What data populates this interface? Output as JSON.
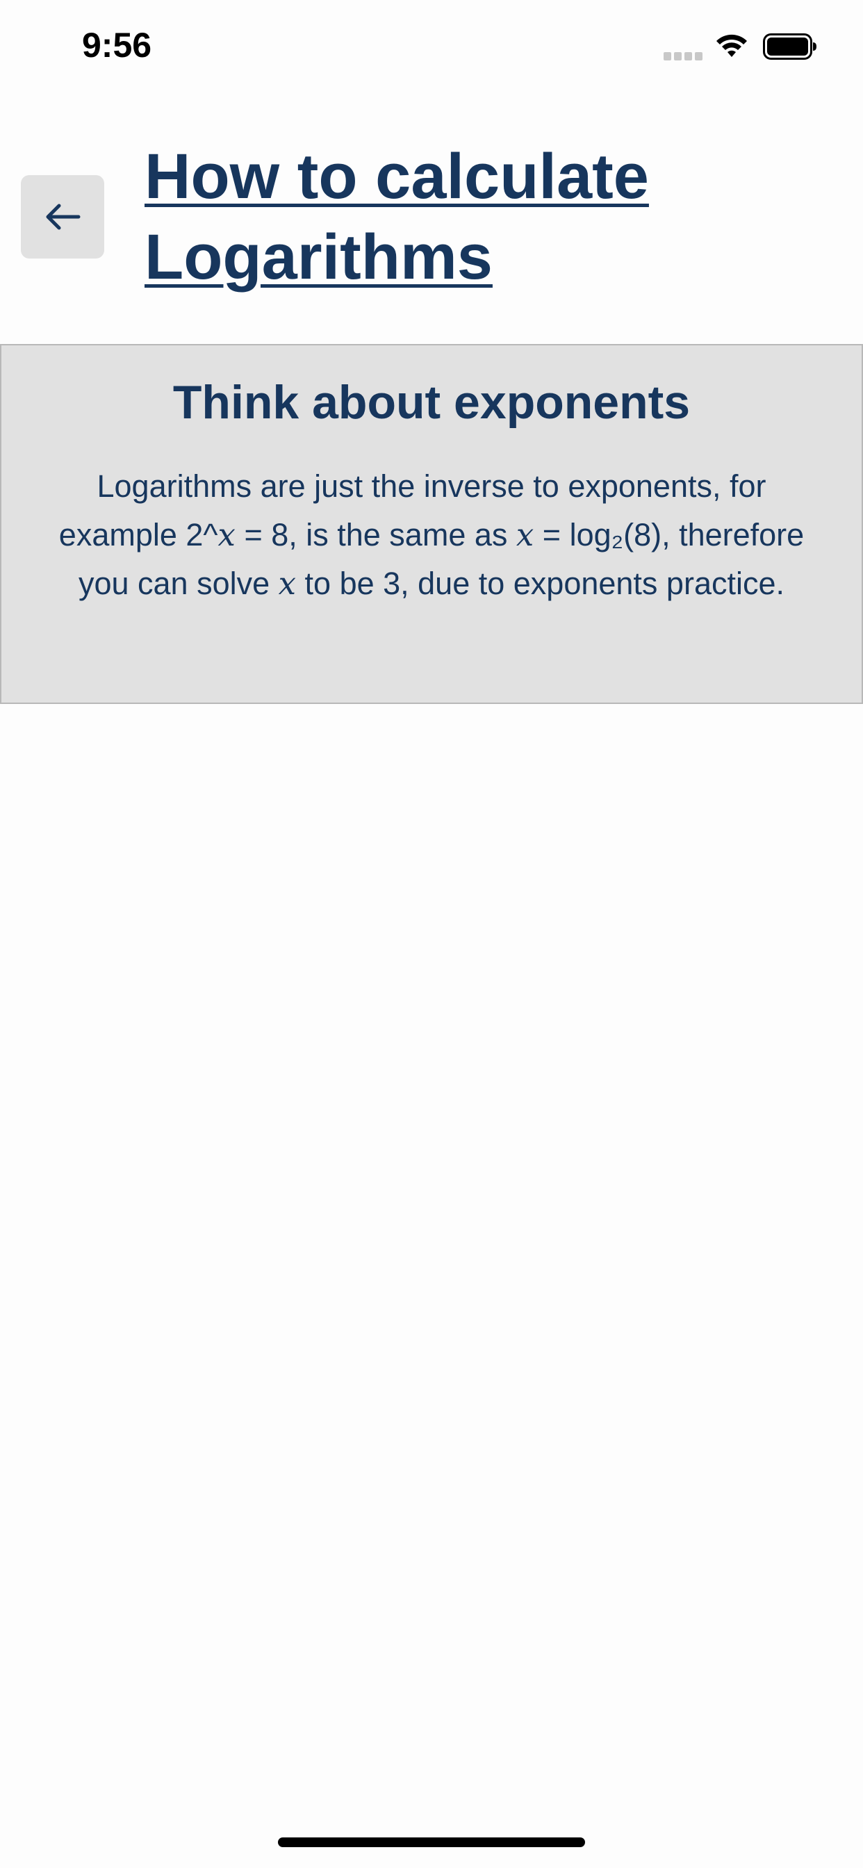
{
  "status_bar": {
    "time": "9:56",
    "icons": [
      "signal-icon",
      "wifi-icon",
      "battery-icon"
    ]
  },
  "header": {
    "back_icon": "arrow-left-icon",
    "title": "How to calculate Logarithms"
  },
  "card": {
    "heading": "Think about exponents",
    "body": {
      "part1": "Logarithms are just the inverse to exponents, for example 2^",
      "var1": "x",
      "part2": " = 8, is the same as ",
      "var2": "x",
      "part3": " = log₂(8), therefore you can solve ",
      "var3": "x",
      "part4": " to be 3, due to exponents practice."
    }
  },
  "colors": {
    "text": "#17365d",
    "card_background": "#e1e1e1",
    "card_border": "#b8b8b8",
    "page_background": "#fdfdfd"
  }
}
